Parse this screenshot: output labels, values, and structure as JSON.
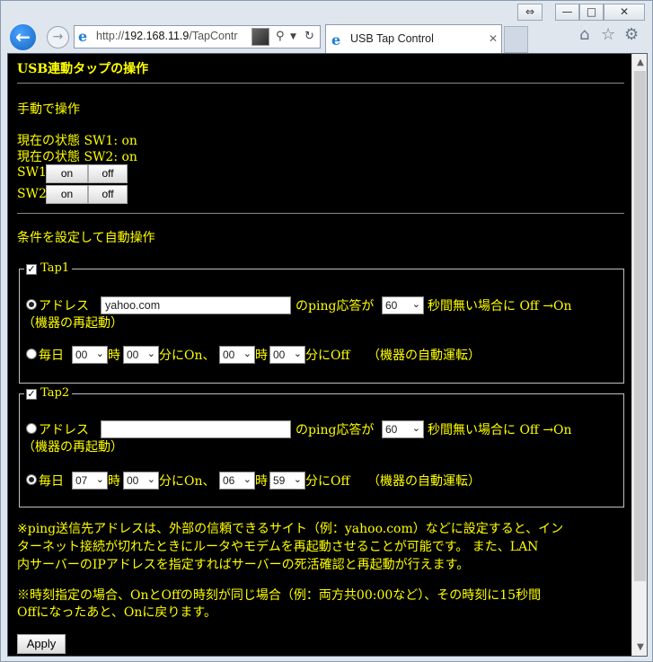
{
  "browser": {
    "address_url_prefix": "http://",
    "address_url_host": "192.168.11.9",
    "address_url_path": "/TapContr",
    "tab_title": "USB Tap Control"
  },
  "page": {
    "heading": "USB連動タップの操作",
    "manual_section": "手動で操作",
    "status_sw1": "現在の状態 SW1: on",
    "status_sw2": "現在の状態 SW2: on",
    "sw1_label": "SW1",
    "sw2_label": "SW2",
    "btn_on": "on",
    "btn_off": "off",
    "auto_section": "条件を設定して自動操作",
    "taps": [
      {
        "legend": "Tap1",
        "checked": true,
        "mode": "address",
        "address_label": "アドレス",
        "address_value": "yahoo.com",
        "ping_text": "のping応答が",
        "seconds": "60",
        "no_response_text": "秒間無い場合に Off →On",
        "reboot_text": "（機器の再起動）",
        "daily_label": "毎日",
        "on_hour": "00",
        "hour_unit": "時",
        "on_minute": "00",
        "on_text": "分にOn、",
        "off_hour": "00",
        "off_minute": "00",
        "off_text": "分にOff",
        "auto_run_text": "（機器の自動運転）"
      },
      {
        "legend": "Tap2",
        "checked": true,
        "mode": "daily",
        "address_label": "アドレス",
        "address_value": "",
        "ping_text": "のping応答が",
        "seconds": "60",
        "no_response_text": "秒間無い場合に Off →On",
        "reboot_text": "（機器の再起動）",
        "daily_label": "毎日",
        "on_hour": "07",
        "hour_unit": "時",
        "on_minute": "00",
        "on_text": "分にOn、",
        "off_hour": "06",
        "off_minute": "59",
        "off_text": "分にOff",
        "auto_run_text": "（機器の自動運転）"
      }
    ],
    "note1_line1": "※ping送信先アドレスは、外部の信頼できるサイト（例：yahoo.com）などに設定すると、イン",
    "note1_line2": "ターネット接続が切れたときにルータやモデムを再起動させることが可能です。 また、LAN",
    "note1_line3": "内サーバーのIPアドレスを指定すればサーバーの死活確認と再起動が行えます。",
    "note2_line1": "※時刻指定の場合、OnとOffの時刻が同じ場合（例：両方共00:00など）、その時刻に15秒間",
    "note2_line2": "Offになったあと、Onに戻ります。",
    "apply_label": "Apply"
  }
}
